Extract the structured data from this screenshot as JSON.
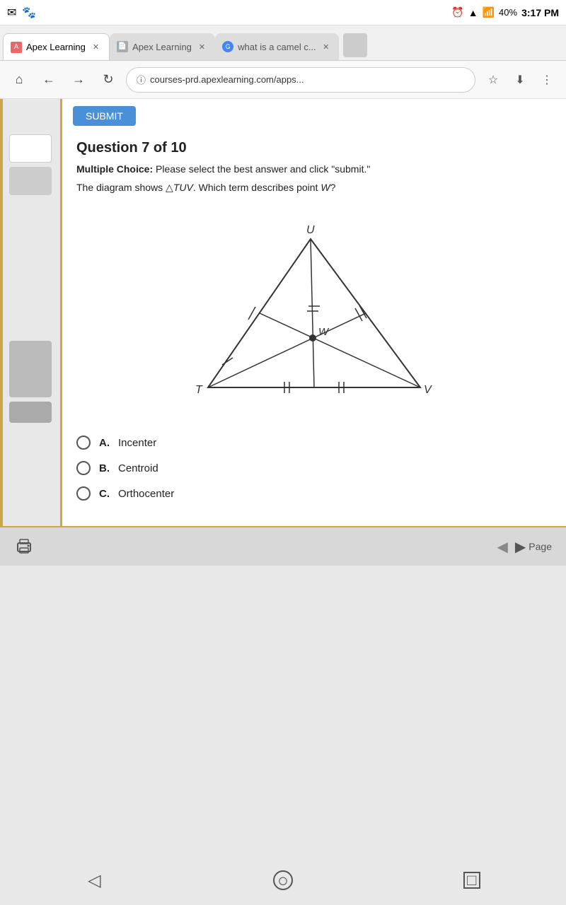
{
  "statusBar": {
    "time": "3:17 PM",
    "battery": "40%",
    "signalBars": "●●●",
    "wifiIcon": "wifi"
  },
  "tabs": [
    {
      "label": "Apex Learning",
      "active": true,
      "favicon": "apex"
    },
    {
      "label": "Apex Learning",
      "active": false,
      "favicon": "doc"
    },
    {
      "label": "what is a camel c...",
      "active": false,
      "favicon": "google"
    }
  ],
  "addressBar": {
    "url": "courses-prd.apexlearning.com/apps...",
    "secureIcon": "ⓘ"
  },
  "submitButton": "SUBMIT",
  "question": {
    "title": "Question 7 of 10",
    "type": "Multiple Choice:",
    "instruction": "Please select the best answer and click \"submit.\"",
    "text": "The diagram shows △TUV. Which term describes point W?"
  },
  "choices": [
    {
      "letter": "A.",
      "text": "Incenter"
    },
    {
      "letter": "B.",
      "text": "Centroid"
    },
    {
      "letter": "C.",
      "text": "Orthocenter"
    }
  ],
  "bottomToolbar": {
    "printLabel": "",
    "pageLabel": "Page"
  },
  "androidNav": {
    "back": "◁",
    "home": "○",
    "recent": "□"
  }
}
